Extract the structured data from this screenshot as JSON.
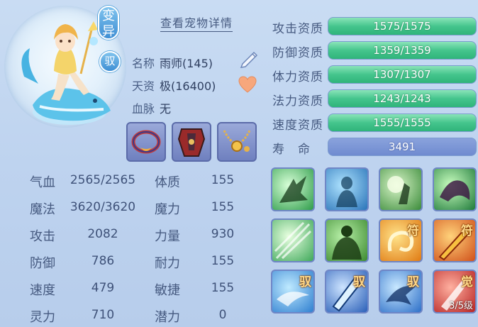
{
  "pet": {
    "variant_badge": "变异",
    "ride_badge": "驭",
    "detail_link": "查看宠物详情",
    "name_label": "名称",
    "name_value": "雨师(145)",
    "talent_label": "天资",
    "talent_value": "极(16400)",
    "bloodline_label": "血脉",
    "bloodline_value": "无"
  },
  "stats_left": [
    {
      "label": "气血",
      "value": "2565/2565"
    },
    {
      "label": "魔法",
      "value": "3620/3620"
    },
    {
      "label": "攻击",
      "value": "2082"
    },
    {
      "label": "防御",
      "value": "786"
    },
    {
      "label": "速度",
      "value": "479"
    },
    {
      "label": "灵力",
      "value": "710"
    }
  ],
  "stats_right": [
    {
      "label": "体质",
      "value": "155"
    },
    {
      "label": "魔力",
      "value": "155"
    },
    {
      "label": "力量",
      "value": "930"
    },
    {
      "label": "耐力",
      "value": "155"
    },
    {
      "label": "敏捷",
      "value": "155"
    },
    {
      "label": "潜力",
      "value": "0"
    }
  ],
  "aptitudes": [
    {
      "label": "攻击资质",
      "value": "1575/1575"
    },
    {
      "label": "防御资质",
      "value": "1359/1359"
    },
    {
      "label": "体力资质",
      "value": "1307/1307"
    },
    {
      "label": "法力资质",
      "value": "1243/1243"
    },
    {
      "label": "速度资质",
      "value": "1555/1555"
    }
  ],
  "lifespan": {
    "label": "寿　命",
    "value": "3491"
  },
  "skills": [
    {
      "icon": "shadow-strike-icon",
      "tag": "",
      "level": ""
    },
    {
      "icon": "spirit-figure-icon",
      "tag": "",
      "level": ""
    },
    {
      "icon": "moon-warrior-icon",
      "tag": "",
      "level": ""
    },
    {
      "icon": "dark-beast-icon",
      "tag": "",
      "level": ""
    },
    {
      "icon": "light-burst-icon",
      "tag": "",
      "level": ""
    },
    {
      "icon": "giant-golem-icon",
      "tag": "",
      "level": ""
    },
    {
      "icon": "swirl-talisman-icon",
      "tag": "符",
      "level": ""
    },
    {
      "icon": "sword-talisman-icon",
      "tag": "符",
      "level": ""
    },
    {
      "icon": "wave-ride-icon",
      "tag": "驭",
      "level": ""
    },
    {
      "icon": "blade-ride-icon",
      "tag": "驭",
      "level": ""
    },
    {
      "icon": "dash-ride-icon",
      "tag": "驭",
      "level": ""
    },
    {
      "icon": "red-awaken-icon",
      "tag": "觉",
      "level": "3/5级"
    }
  ],
  "colors": {
    "bar_green": "#3fc28a",
    "bar_blue": "#7690d3",
    "panel_bg": "#c3d7f1"
  }
}
